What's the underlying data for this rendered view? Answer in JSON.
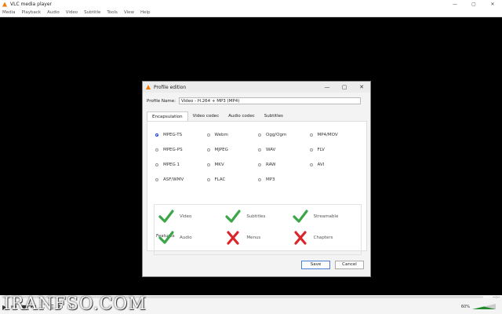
{
  "window": {
    "title": "VLC media player",
    "minimize": "—",
    "maximize": "▢",
    "close": "✕"
  },
  "menu": [
    "Media",
    "Playback",
    "Audio",
    "Video",
    "Subtitle",
    "Tools",
    "View",
    "Help"
  ],
  "dialog": {
    "title": "Profile edition",
    "minimize": "—",
    "maximize": "▢",
    "close": "✕",
    "profile_name_label": "Profile Name:",
    "profile_name_value": "Video - H.264 + MP3 (MP4)",
    "tabs": [
      "Encapsulation",
      "Video codec",
      "Audio codec",
      "Subtitles"
    ],
    "active_tab": 0,
    "encapsulations": [
      {
        "label": "MPEG-TS",
        "selected": true
      },
      {
        "label": "Webm",
        "selected": false
      },
      {
        "label": "Ogg/Ogm",
        "selected": false
      },
      {
        "label": "MP4/MOV",
        "selected": false
      },
      {
        "label": "MPEG-PS",
        "selected": false
      },
      {
        "label": "MJPEG",
        "selected": false
      },
      {
        "label": "WAV",
        "selected": false
      },
      {
        "label": "FLV",
        "selected": false
      },
      {
        "label": "MPEG 1",
        "selected": false
      },
      {
        "label": "MKV",
        "selected": false
      },
      {
        "label": "RAW",
        "selected": false
      },
      {
        "label": "AVI",
        "selected": false
      },
      {
        "label": "ASF/WMV",
        "selected": false
      },
      {
        "label": "FLAC",
        "selected": false
      },
      {
        "label": "MP3",
        "selected": false
      }
    ],
    "features_label": "Features",
    "features": [
      {
        "label": "Video",
        "supported": true
      },
      {
        "label": "Subtitles",
        "supported": true
      },
      {
        "label": "Streamable",
        "supported": true
      },
      {
        "label": "Audio",
        "supported": true
      },
      {
        "label": "Menus",
        "supported": false
      },
      {
        "label": "Chapters",
        "supported": false
      }
    ],
    "save_label": "Save",
    "cancel_label": "Cancel"
  },
  "player": {
    "time_right": "--:--",
    "volume": "60%"
  },
  "watermark": "IRANFSO.COM",
  "colors": {
    "check": "#3aa648",
    "cross": "#d8262b",
    "accent": "#f47a00"
  }
}
